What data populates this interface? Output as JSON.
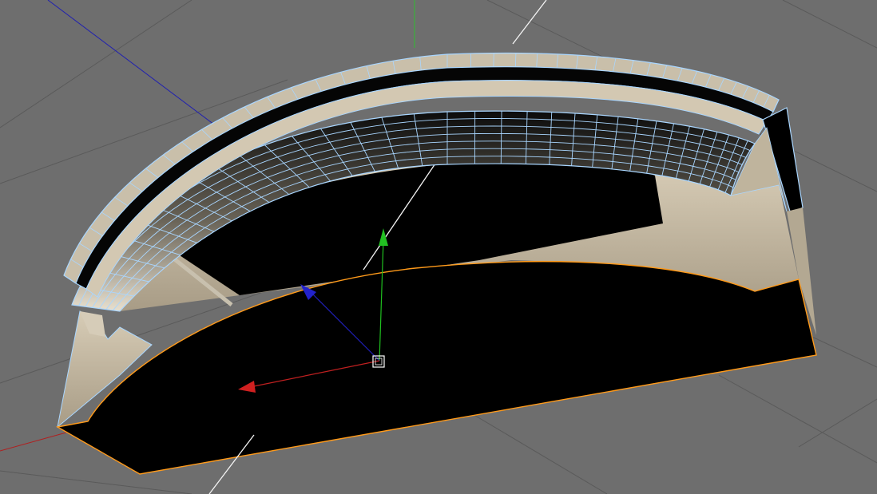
{
  "viewport": {
    "background": "#6e6e6e",
    "grid_color": "#555555",
    "axis_colors": {
      "x": "#c02020",
      "y": "#20c020",
      "z": "#2020c0"
    }
  },
  "object": {
    "fill": "#000000",
    "edge_highlight": "#ff9a1a",
    "wire_color": "#a9d6ff",
    "stone_color": "#c2b7a2"
  },
  "gizmo": {
    "icons": [
      "move-x-arrow-icon",
      "move-y-arrow-icon",
      "move-z-arrow-icon",
      "pivot-box-icon"
    ]
  }
}
